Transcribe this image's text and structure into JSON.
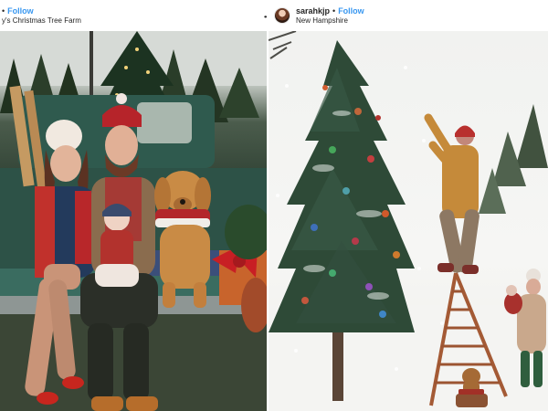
{
  "posts": [
    {
      "header": {
        "username": "",
        "follow_label": "Follow",
        "location": "y's Christmas Tree Farm"
      },
      "photo": {
        "subject": "family-with-dog-on-truck-tailgate"
      }
    },
    {
      "header": {
        "username": "sarahkjp",
        "follow_label": "Follow",
        "location": "New Hampshire"
      },
      "photo": {
        "subject": "decorating-tree-on-ladder-in-snow"
      }
    }
  ],
  "ui": {
    "separator": "•",
    "more_menu": "••"
  },
  "colors": {
    "follow_blue": "#3897f0",
    "text_dark": "#262626",
    "page_bg": "#ffffff"
  }
}
